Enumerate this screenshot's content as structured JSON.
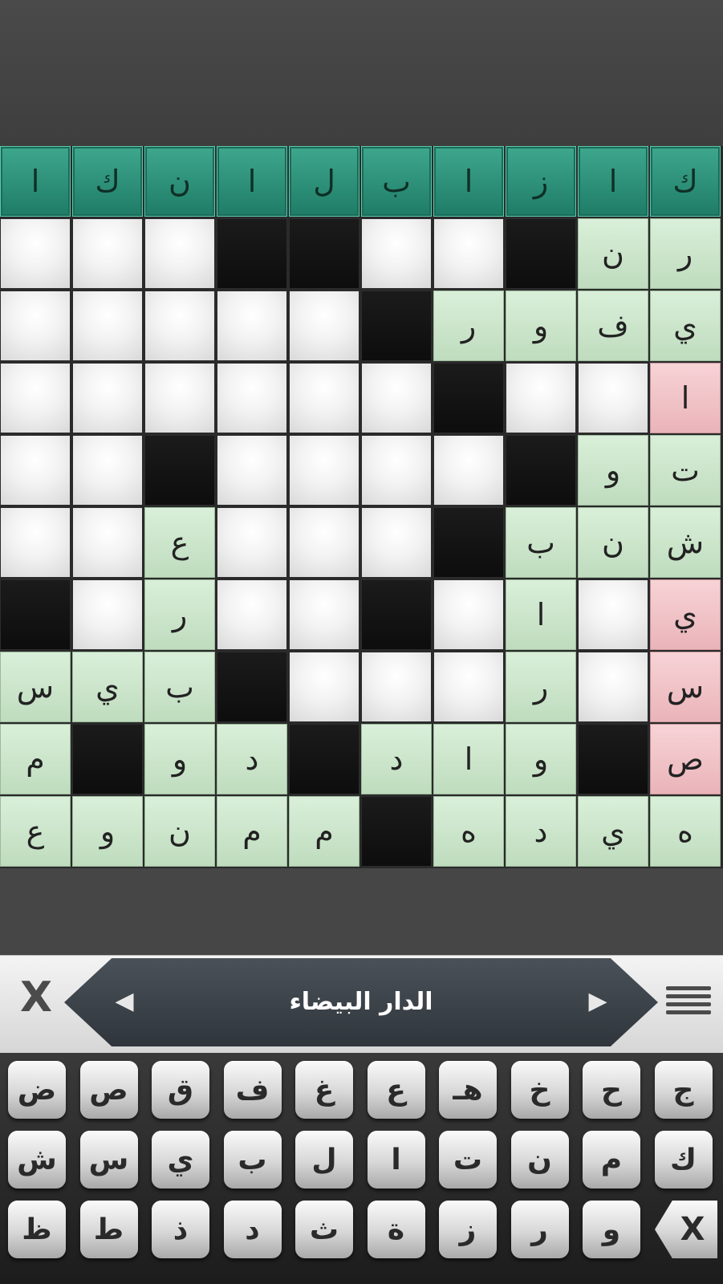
{
  "colors": {
    "header_teal": "#2a927a",
    "correct_green": "#cce6cb",
    "error_pink": "#f0c2c6",
    "black_cell": "#111111",
    "background": "#464646"
  },
  "grid": {
    "cols": 10,
    "header_row": [
      "ا",
      "ك",
      "ن",
      "ا",
      "ل",
      "ب",
      "ا",
      "ز",
      "ا",
      "ك"
    ],
    "rows": [
      [
        {
          "t": "w"
        },
        {
          "t": "w"
        },
        {
          "t": "w"
        },
        {
          "t": "b"
        },
        {
          "t": "b"
        },
        {
          "t": "w"
        },
        {
          "t": "w"
        },
        {
          "t": "b"
        },
        {
          "t": "g",
          "c": "ن"
        },
        {
          "t": "g",
          "c": "ر"
        }
      ],
      [
        {
          "t": "w"
        },
        {
          "t": "w"
        },
        {
          "t": "w"
        },
        {
          "t": "w"
        },
        {
          "t": "w"
        },
        {
          "t": "b"
        },
        {
          "t": "g",
          "c": "ر"
        },
        {
          "t": "g",
          "c": "و"
        },
        {
          "t": "g",
          "c": "ف"
        },
        {
          "t": "g",
          "c": "ي"
        }
      ],
      [
        {
          "t": "w"
        },
        {
          "t": "w"
        },
        {
          "t": "w"
        },
        {
          "t": "w"
        },
        {
          "t": "w"
        },
        {
          "t": "w"
        },
        {
          "t": "b"
        },
        {
          "t": "w"
        },
        {
          "t": "w"
        },
        {
          "t": "p",
          "c": "ا"
        }
      ],
      [
        {
          "t": "w"
        },
        {
          "t": "w"
        },
        {
          "t": "b"
        },
        {
          "t": "w"
        },
        {
          "t": "w"
        },
        {
          "t": "w"
        },
        {
          "t": "w"
        },
        {
          "t": "b"
        },
        {
          "t": "g",
          "c": "و"
        },
        {
          "t": "g",
          "c": "ت"
        }
      ],
      [
        {
          "t": "w"
        },
        {
          "t": "w"
        },
        {
          "t": "g",
          "c": "ع"
        },
        {
          "t": "w"
        },
        {
          "t": "w"
        },
        {
          "t": "w"
        },
        {
          "t": "b"
        },
        {
          "t": "g",
          "c": "ب"
        },
        {
          "t": "g",
          "c": "ن"
        },
        {
          "t": "g",
          "c": "ش"
        }
      ],
      [
        {
          "t": "b"
        },
        {
          "t": "w"
        },
        {
          "t": "g",
          "c": "ر"
        },
        {
          "t": "w"
        },
        {
          "t": "w"
        },
        {
          "t": "b"
        },
        {
          "t": "w"
        },
        {
          "t": "g",
          "c": "ا"
        },
        {
          "t": "w"
        },
        {
          "t": "p",
          "c": "ي"
        }
      ],
      [
        {
          "t": "g",
          "c": "س"
        },
        {
          "t": "g",
          "c": "ي"
        },
        {
          "t": "g",
          "c": "ب"
        },
        {
          "t": "b"
        },
        {
          "t": "w"
        },
        {
          "t": "w"
        },
        {
          "t": "w"
        },
        {
          "t": "g",
          "c": "ر"
        },
        {
          "t": "w"
        },
        {
          "t": "p",
          "c": "س"
        }
      ],
      [
        {
          "t": "g",
          "c": "م"
        },
        {
          "t": "b"
        },
        {
          "t": "g",
          "c": "و"
        },
        {
          "t": "g",
          "c": "د"
        },
        {
          "t": "b"
        },
        {
          "t": "g",
          "c": "د"
        },
        {
          "t": "g",
          "c": "ا"
        },
        {
          "t": "g",
          "c": "و"
        },
        {
          "t": "b"
        },
        {
          "t": "p",
          "c": "ص"
        }
      ],
      [
        {
          "t": "g",
          "c": "ع"
        },
        {
          "t": "g",
          "c": "و"
        },
        {
          "t": "g",
          "c": "ن"
        },
        {
          "t": "g",
          "c": "م"
        },
        {
          "t": "g",
          "c": "م"
        },
        {
          "t": "b"
        },
        {
          "t": "g",
          "c": "ه"
        },
        {
          "t": "g",
          "c": "د"
        },
        {
          "t": "g",
          "c": "ي"
        },
        {
          "t": "g",
          "c": "ه"
        }
      ]
    ]
  },
  "clue_bar": {
    "clear_label": "X",
    "clue": "الدار البيضاء",
    "prev_icon": "◀",
    "next_icon": "▶",
    "menu_icon": "menu-icon"
  },
  "keyboard": {
    "rows": [
      [
        "ض",
        "ص",
        "ق",
        "ف",
        "غ",
        "ع",
        "هـ",
        "خ",
        "ح",
        "ج"
      ],
      [
        "ش",
        "س",
        "ي",
        "ب",
        "ل",
        "ا",
        "ت",
        "ن",
        "م",
        "ك"
      ],
      [
        "ظ",
        "ط",
        "ذ",
        "د",
        "ث",
        "ة",
        "ز",
        "ر",
        "و"
      ]
    ],
    "backspace_label": "X"
  }
}
